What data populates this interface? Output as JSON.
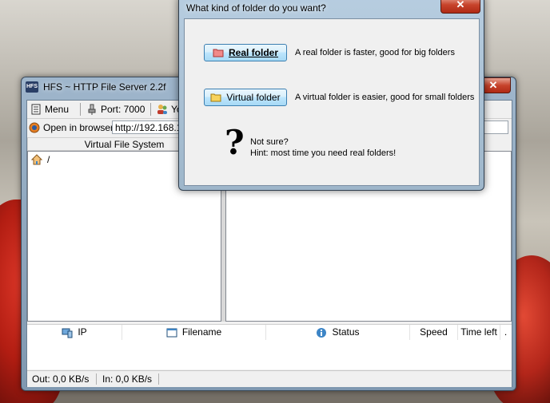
{
  "main_window": {
    "title": "HFS ~ HTTP File Server 2.2f",
    "app_icon_text": "HFS",
    "close_glyph": "✕",
    "toolbar": {
      "menu_label": "Menu",
      "port_label": "Port: 7000",
      "you_label": "Yo"
    },
    "open_in_browser_label": "Open in browser",
    "url_value": "http://192.168.1",
    "vfs_header": "Virtual File System",
    "vfs_root": "/",
    "columns": {
      "ip": "IP",
      "filename": "Filename",
      "status": "Status",
      "speed": "Speed",
      "time_left": "Time left",
      "extra": "."
    },
    "status": {
      "out": "Out: 0,0 KB/s",
      "in": "In: 0,0 KB/s"
    }
  },
  "dialog": {
    "title": "What kind of folder do you want?",
    "close_glyph": "✕",
    "real_button": "Real folder",
    "real_desc": "A real folder is faster, good for big folders",
    "virtual_button": "Virtual folder",
    "virtual_desc": "A virtual folder is easier, good for small folders",
    "question_mark": "?",
    "hint_line1": "Not sure?",
    "hint_line2": "Hint: most time you need real folders!"
  },
  "colors": {
    "window_frame": "#9fb6cc",
    "close_red": "#c7432b",
    "button_blue": "#bee6fd"
  },
  "icons": [
    "menu-icon",
    "port-icon",
    "users-icon",
    "browser-icon",
    "home-icon",
    "ip-icon",
    "filename-icon",
    "status-icon",
    "red-folder-icon",
    "yellow-folder-icon"
  ]
}
